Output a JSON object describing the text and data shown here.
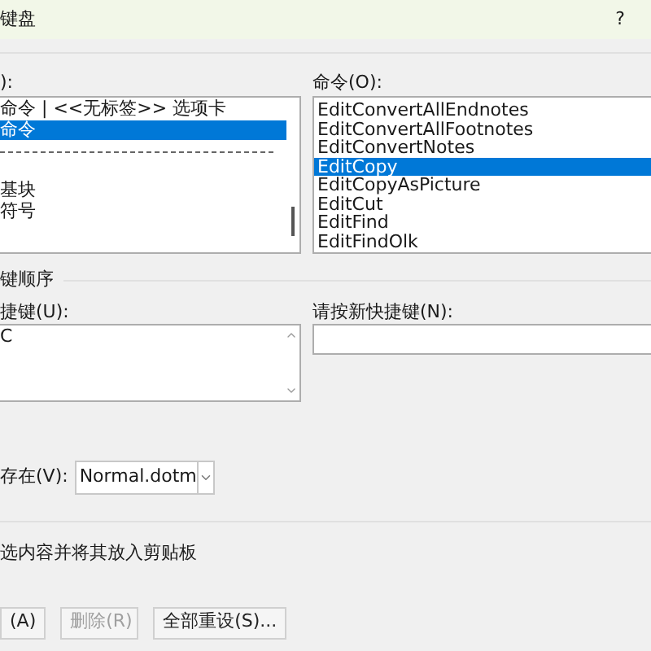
{
  "window": {
    "title": "键盘",
    "help": "?"
  },
  "categories": {
    "label": "):",
    "items": [
      {
        "text": "命令 | <<无标签>> 选项卡",
        "kind": "item",
        "selected": false
      },
      {
        "text": "命令",
        "kind": "item",
        "selected": true
      },
      {
        "kind": "separator"
      },
      {
        "kind": "blank"
      },
      {
        "text": "基块",
        "kind": "item",
        "selected": false
      },
      {
        "text": "符号",
        "kind": "item",
        "selected": false
      }
    ]
  },
  "commands": {
    "label": "命令(O):",
    "items": [
      {
        "text": "EditConvertAllEndnotes",
        "selected": false
      },
      {
        "text": "EditConvertAllFootnotes",
        "selected": false
      },
      {
        "text": "EditConvertNotes",
        "selected": false
      },
      {
        "text": "EditCopy",
        "selected": true
      },
      {
        "text": "EditCopyAsPicture",
        "selected": false
      },
      {
        "text": "EditCut",
        "selected": false
      },
      {
        "text": "EditFind",
        "selected": false
      },
      {
        "text": "EditFindOlk",
        "selected": false
      }
    ]
  },
  "sequence": {
    "title": "键顺序",
    "current_label": "捷键(U):",
    "current_keys": [
      "C"
    ],
    "new_label": "请按新快捷键(N):"
  },
  "save_in": {
    "label": "存在(V):",
    "value": "Normal.dotm"
  },
  "description": "选内容并将其放入剪贴板",
  "buttons": [
    {
      "label": "(A)",
      "disabled": false
    },
    {
      "label": "删除(R)",
      "disabled": true
    },
    {
      "label": "全部重设(S)...",
      "disabled": false
    }
  ]
}
